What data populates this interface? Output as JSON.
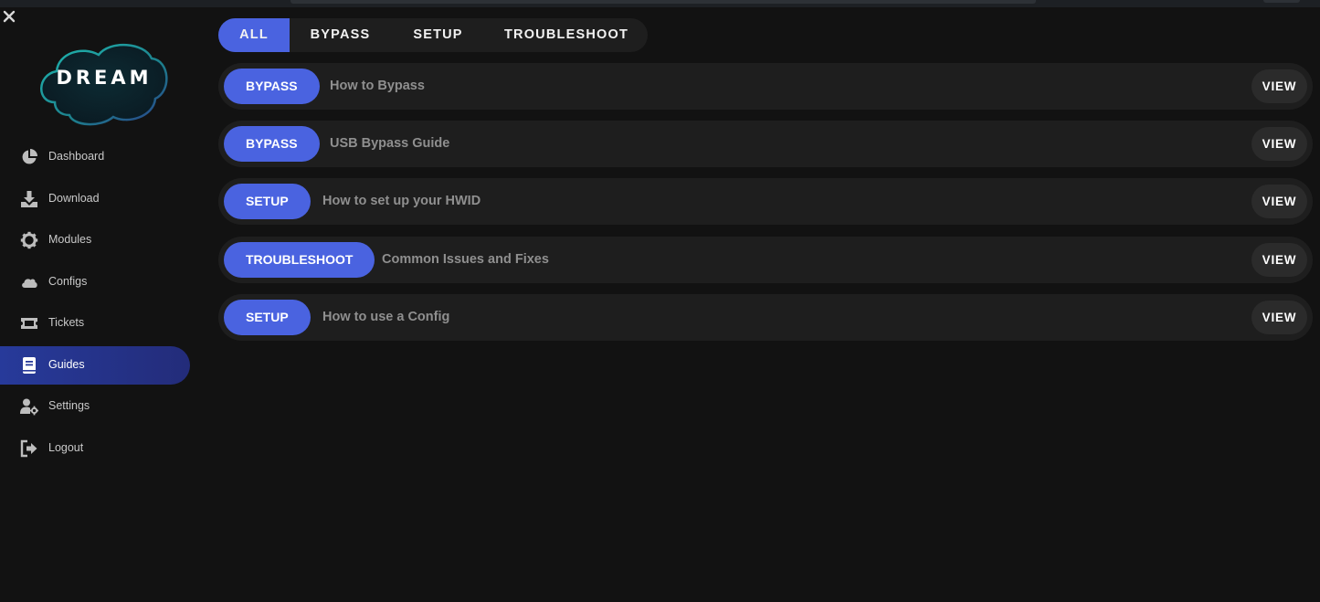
{
  "brand": {
    "logo_text": "DREAM"
  },
  "sidebar": {
    "items": [
      {
        "label": "Dashboard",
        "icon": "pie-chart-icon",
        "active": false
      },
      {
        "label": "Download",
        "icon": "download-icon",
        "active": false
      },
      {
        "label": "Modules",
        "icon": "gear-icon",
        "active": false
      },
      {
        "label": "Configs",
        "icon": "cloud-icon",
        "active": false
      },
      {
        "label": "Tickets",
        "icon": "ticket-icon",
        "active": false
      },
      {
        "label": "Guides",
        "icon": "book-icon",
        "active": true
      },
      {
        "label": "Settings",
        "icon": "user-gear-icon",
        "active": false
      },
      {
        "label": "Logout",
        "icon": "logout-icon",
        "active": false
      }
    ]
  },
  "filters": {
    "tabs": [
      {
        "label": "ALL",
        "active": true
      },
      {
        "label": "BYPASS",
        "active": false
      },
      {
        "label": "SETUP",
        "active": false
      },
      {
        "label": "TROUBLESHOOT",
        "active": false
      }
    ]
  },
  "guides": [
    {
      "category": "BYPASS",
      "title": "How to Bypass",
      "action": "VIEW"
    },
    {
      "category": "BYPASS",
      "title": "USB Bypass Guide",
      "action": "VIEW"
    },
    {
      "category": "SETUP",
      "title": "How to set up your HWID",
      "action": "VIEW"
    },
    {
      "category": "TROUBLESHOOT",
      "title": "Common Issues and Fixes",
      "action": "VIEW"
    },
    {
      "category": "SETUP",
      "title": "How to use a Config",
      "action": "VIEW"
    }
  ],
  "colors": {
    "accent": "#4a63e0",
    "active_nav": "#273a9a",
    "background": "#121212",
    "panel": "#1e1e1e"
  }
}
